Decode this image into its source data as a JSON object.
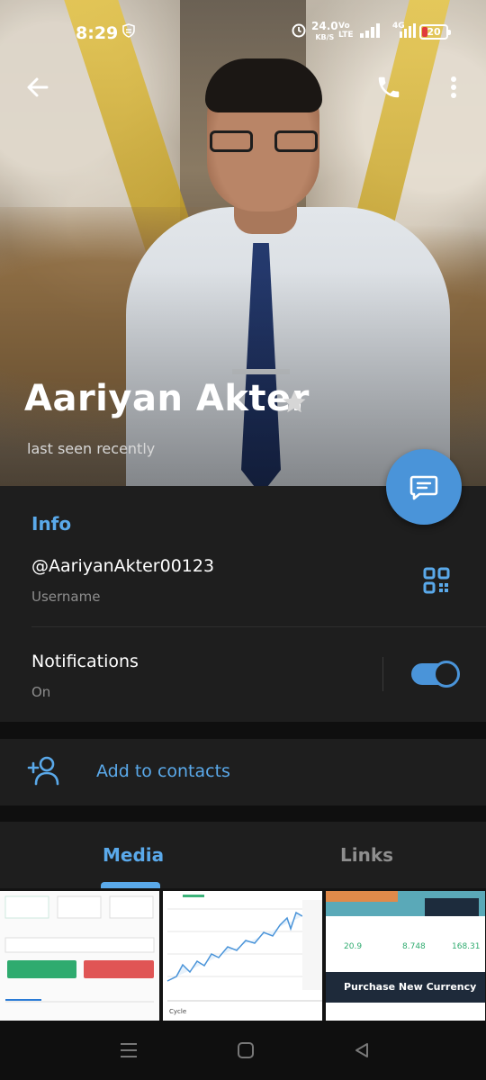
{
  "status_bar": {
    "time": "8:29",
    "net_speed_value": "24.0",
    "net_speed_unit": "KB/S",
    "volte_top": "Vo",
    "volte_bottom": "LTE",
    "network_type": "4G",
    "battery": "20",
    "battery_level_percent": 20,
    "battery_color": "#e03b3b"
  },
  "header": {
    "back_icon": "arrow-left-icon",
    "call_icon": "phone-icon",
    "more_icon": "more-vertical-icon"
  },
  "profile": {
    "name": "Aariyan Akter",
    "star_icon": "star-icon",
    "status": "last seen recently"
  },
  "fab": {
    "icon": "message-icon"
  },
  "info": {
    "title": "Info",
    "username": "@AariyanAkter00123",
    "username_label": "Username",
    "qr_icon": "qr-code-icon",
    "notifications_label": "Notifications",
    "notifications_value": "On",
    "notifications_enabled": true
  },
  "actions": {
    "add_contact_label": "Add to contacts",
    "add_contact_icon": "add-user-icon"
  },
  "tabs": [
    {
      "label": "Media",
      "active": true
    },
    {
      "label": "Links",
      "active": false
    }
  ],
  "media": {
    "thumb3_banner": "Purchase New Currency",
    "thumb2_caption": "Cycle"
  },
  "colors": {
    "accent": "#5aa9ea",
    "fab": "#4a94d9",
    "panel": "#1e1e1e",
    "background": "#0f0f0f"
  }
}
